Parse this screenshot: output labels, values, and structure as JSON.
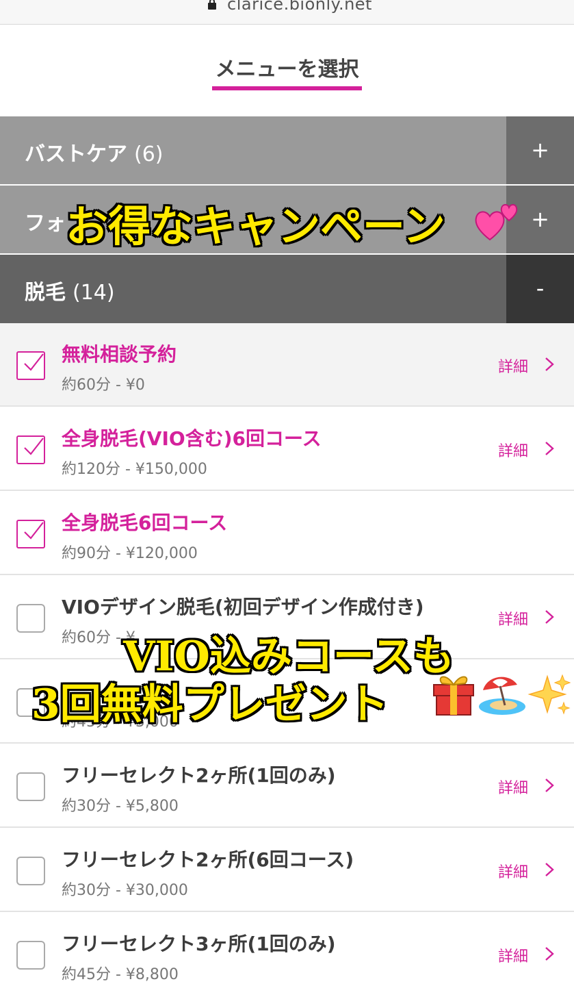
{
  "browser": {
    "url": "clarice.bionly.net"
  },
  "tab": {
    "label": "メニューを選択"
  },
  "categories": [
    {
      "name": "バストケア",
      "count": "(6)",
      "toggle": "+"
    },
    {
      "name": "フォ",
      "count": "",
      "toggle": "+"
    },
    {
      "name": "脱毛",
      "count": "(14)",
      "toggle": "-"
    }
  ],
  "items": [
    {
      "name": "無料相談予約",
      "meta": "約60分 - ¥0",
      "detail": "詳細",
      "checked": true
    },
    {
      "name": "全身脱毛(VIO含む)6回コース",
      "meta": "約120分 - ¥150,000",
      "detail": "詳細",
      "checked": true
    },
    {
      "name": "全身脱毛6回コース",
      "meta": "約90分 - ¥120,000",
      "detail": "",
      "checked": true
    },
    {
      "name": "VIOデザイン脱毛(初回デザイン作成付き)",
      "meta": "約60分 - ¥",
      "detail": "詳細",
      "checked": false
    },
    {
      "name": "",
      "meta": "約45分 - ¥5,000",
      "detail": "",
      "checked": false
    },
    {
      "name": "フリーセレクト2ヶ所(1回のみ)",
      "meta": "約30分 - ¥5,800",
      "detail": "詳細",
      "checked": false
    },
    {
      "name": "フリーセレクト2ヶ所(6回コース)",
      "meta": "約30分 - ¥30,000",
      "detail": "詳細",
      "checked": false
    },
    {
      "name": "フリーセレクト3ヶ所(1回のみ)",
      "meta": "約45分 - ¥8,800",
      "detail": "詳細",
      "checked": false
    }
  ],
  "overlay": {
    "caption1": "お得なキャンペーン",
    "caption2": "VIO込みコースも",
    "caption3": "3回無料プレゼント"
  },
  "colors": {
    "accent": "#d4219b",
    "category_light": "#9a9a9a",
    "category_dark": "#636363",
    "caption_yellow": "#ffea00"
  }
}
